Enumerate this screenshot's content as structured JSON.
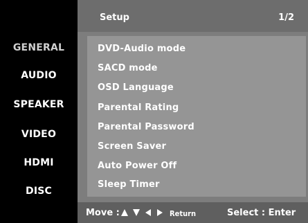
{
  "header": {
    "title": "Setup",
    "page": "1/2"
  },
  "categories": [
    {
      "label": "GENERAL"
    },
    {
      "label": "AUDIO"
    },
    {
      "label": "SPEAKER"
    },
    {
      "label": "VIDEO"
    },
    {
      "label": "HDMI"
    },
    {
      "label": "DISC"
    }
  ],
  "menu": {
    "items": [
      {
        "label": "DVD-Audio mode"
      },
      {
        "label": "SACD mode"
      },
      {
        "label": "OSD Language"
      },
      {
        "label": "Parental Rating"
      },
      {
        "label": "Parental Password"
      },
      {
        "label": "Screen Saver"
      },
      {
        "label": "Auto Power Off"
      },
      {
        "label": "Sleep Timer"
      }
    ]
  },
  "footer": {
    "move_label": "Move :",
    "return_label": "Return",
    "select_label": "Select : Enter",
    "arrow_icons": [
      "up-arrow-icon",
      "down-arrow-icon",
      "left-arrow-icon",
      "right-arrow-icon"
    ]
  },
  "colors": {
    "background": "#000000",
    "screen": "#7d7d7d",
    "menu_panel": "#959595",
    "text": "#ffffff"
  }
}
